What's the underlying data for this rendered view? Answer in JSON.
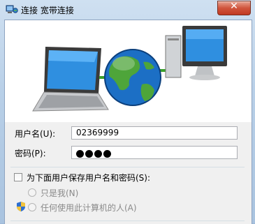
{
  "window": {
    "title": "连接 宽带连接",
    "close_label": "✕"
  },
  "form": {
    "username_label": "用户名(U):",
    "username_value": "02369999",
    "password_label": "密码(P):",
    "password_dots": 4,
    "save_label": "为下面用户保存用户名和密码(S):",
    "only_me_label": "只是我(N)",
    "anyone_label": "任何使用此计算机的人(A)"
  },
  "colors": {
    "accent": "#c13a22",
    "green_link": "#3aa12a"
  }
}
